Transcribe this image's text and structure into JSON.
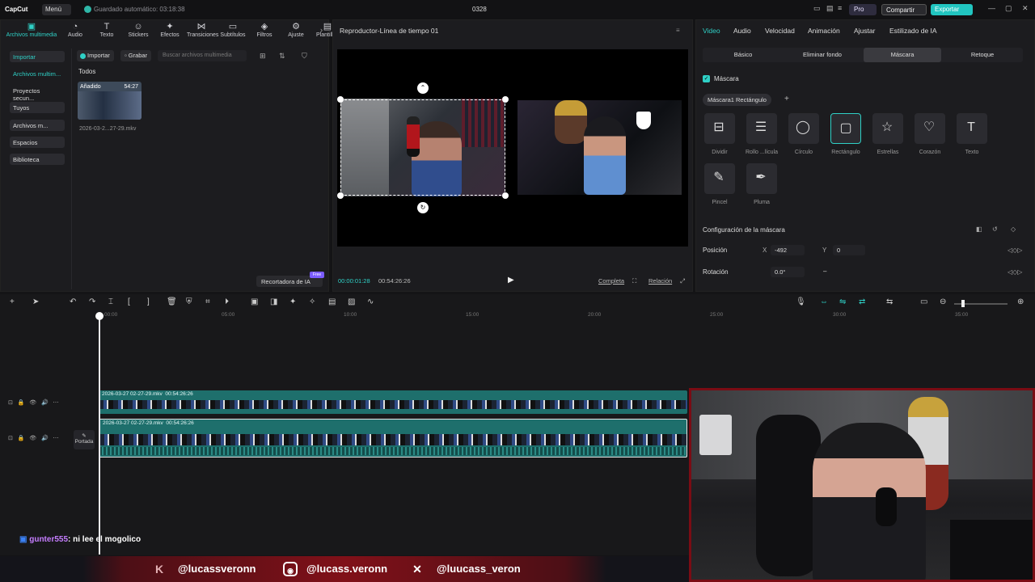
{
  "titlebar": {
    "app": "CapCut",
    "menu": "Menú",
    "autosave": "Guardado automático: 03:18:38",
    "project": "0328",
    "pro": "Pro",
    "share": "Compartir",
    "export": "Exportar"
  },
  "left_tools": [
    {
      "label": "Archivos multimedia",
      "icon": "media-icon",
      "active": true
    },
    {
      "label": "Audio",
      "icon": "audio-icon"
    },
    {
      "label": "Texto",
      "icon": "text-icon"
    },
    {
      "label": "Stickers",
      "icon": "sticker-icon"
    },
    {
      "label": "Efectos",
      "icon": "effects-icon"
    },
    {
      "label": "Transiciones",
      "icon": "transitions-icon"
    },
    {
      "label": "Subtítulos",
      "icon": "subtitles-icon"
    },
    {
      "label": "Filtros",
      "icon": "filters-icon"
    },
    {
      "label": "Ajuste",
      "icon": "adjust-icon"
    },
    {
      "label": "Plantillas",
      "icon": "templates-icon"
    }
  ],
  "sidebar": [
    "Importar",
    "Archivos multim...",
    "Proyectos secun...",
    "Tuyos",
    "Archivos m...",
    "Espacios",
    "Biblioteca"
  ],
  "media": {
    "import_btn": "Importar",
    "record_btn": "Grabar",
    "search_placeholder": "Buscar archivos multimedia",
    "filter_all": "Todos",
    "thumb_badge": "Añadido",
    "thumb_duration": "54:27",
    "thumb_name": "2026-03-2...27-29.mkv",
    "recortadora": "Recortadora de IA",
    "gratis": "Free"
  },
  "player": {
    "title": "Reproductor-Línea de tiempo 01",
    "current_time": "00:00:01:28",
    "total_time": "00:54:26:26",
    "complete": "Completa",
    "ratio": "Relación"
  },
  "right_panel": {
    "tabs": [
      "Video",
      "Audio",
      "Velocidad",
      "Animación",
      "Ajustar",
      "Estilizado de IA"
    ],
    "subtabs": [
      "Básico",
      "Eliminar fondo",
      "Máscara",
      "Retoque"
    ],
    "mask_check": "Máscara",
    "mask_chip": "Máscara1 Rectángulo",
    "masks": [
      {
        "label": "Dividir",
        "glyph": "⊟"
      },
      {
        "label": "Rollo ...lícula",
        "glyph": "☰"
      },
      {
        "label": "Círculo",
        "glyph": "◯"
      },
      {
        "label": "Rectángulo",
        "glyph": "▢"
      },
      {
        "label": "Estrellas",
        "glyph": "☆"
      },
      {
        "label": "Corazón",
        "glyph": "♡"
      },
      {
        "label": "Texto",
        "glyph": "T"
      },
      {
        "label": "Pincel",
        "glyph": "✎"
      },
      {
        "label": "Pluma",
        "glyph": "✒"
      }
    ],
    "config": "Configuración de la máscara",
    "position_label": "Posición",
    "pos_x_label": "X",
    "pos_x": "-492",
    "pos_y_label": "Y",
    "pos_y": "0",
    "rotation_label": "Rotación",
    "rotation": "0.0°",
    "rotation_extra": "–"
  },
  "timeline": {
    "ruler": [
      "00:00",
      "05:00",
      "10:00",
      "15:00",
      "20:00",
      "25:00",
      "30:00",
      "35:00"
    ],
    "clip1_name": "2026-03-27 02-27-29.mkv",
    "clip1_dur": "00:54:26:26",
    "clip2_name": "2026-03-27 02-27-29.mkv",
    "clip2_dur": "00:54:26:26",
    "cover": "Portada"
  },
  "chat": {
    "user": "gunter555",
    "message": ": ni lee el mogolico"
  },
  "socials": [
    {
      "icon": "kick-icon",
      "handle": "@lucassveronn"
    },
    {
      "icon": "instagram-icon",
      "handle": "@lucass.veronn"
    },
    {
      "icon": "x-icon",
      "handle": "@luucass_veron"
    }
  ],
  "colors": {
    "accent": "#2fd0c6",
    "banner": "#801018",
    "clip": "#1e6f6c"
  }
}
